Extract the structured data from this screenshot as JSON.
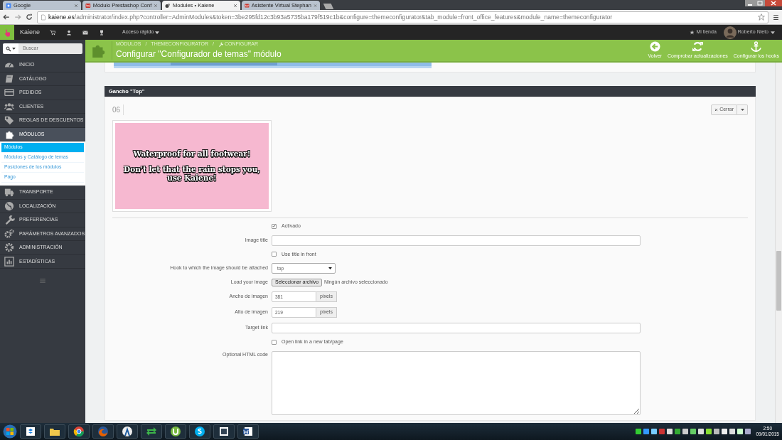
{
  "browser": {
    "tabs": [
      {
        "title": "Google",
        "selected": false
      },
      {
        "title": "Módulo Prestashop Conf",
        "selected": false
      },
      {
        "title": "Modules • Kaiene",
        "selected": true
      },
      {
        "title": "Asistente Virtual Stephan",
        "selected": false
      }
    ],
    "url_host": "kaiene.es",
    "url_path": "/administrator/index.php?controller=AdminModules&token=3be295fd12c3b93a5735ba179f519c1b&configure=themeconfigurator&tab_module=front_office_features&module_name=themeconfigurator"
  },
  "topbar": {
    "shop": "Kaiene",
    "quick_access": "Acceso rápido",
    "store_link": "Mi tienda",
    "user": "Roberto Nieto"
  },
  "sidebar": {
    "search_placeholder": "Buscar",
    "items": [
      {
        "label": "INICIO",
        "selected": false
      },
      {
        "label": "CATÁLOGO",
        "selected": false
      },
      {
        "label": "PEDIDOS",
        "selected": false
      },
      {
        "label": "CLIENTES",
        "selected": false
      },
      {
        "label": "REGLAS DE DESCUENTOS",
        "selected": false
      },
      {
        "label": "MÓDULOS",
        "selected": true,
        "children": [
          {
            "label": "Módulos",
            "selected": true
          },
          {
            "label": "Módulos y Catálogo de temas",
            "selected": false
          },
          {
            "label": "Posiciones de los módulos",
            "selected": false
          },
          {
            "label": "Pago",
            "selected": false
          }
        ]
      },
      {
        "label": "TRANSPORTE",
        "selected": false
      },
      {
        "label": "LOCALIZACIÓN",
        "selected": false
      },
      {
        "label": "PREFERENCIAS",
        "selected": false
      },
      {
        "label": "PARÁMETROS AVANZADOS",
        "selected": false
      },
      {
        "label": "ADMINISTRACIÓN",
        "selected": false
      },
      {
        "label": "ESTADÍSTICAS",
        "selected": false
      }
    ]
  },
  "header": {
    "breadcrumb": [
      "MÓDULOS",
      "THEMECONFIGURATOR",
      "CONFIGURAR"
    ],
    "breadcrumb_separators": [
      "/",
      "/"
    ],
    "title": "Configurar \"Configurador de temas\" módulo",
    "actions": [
      "Volver",
      "Comprobar actualizaciones",
      "Configurar los hooks"
    ]
  },
  "panel": {
    "title": "Gancho \"Top\"",
    "item_number": "06",
    "close_button": "Cerrar",
    "banner_lines": [
      "Waterproof for all footwear!",
      "Don't let that the rain stops you, use Kaiene!"
    ],
    "fields": [
      {
        "kind": "checkbox",
        "label": "Activado",
        "checked": true
      },
      {
        "kind": "text",
        "label": "Image title"
      },
      {
        "kind": "checkbox",
        "label": "Use title in front",
        "checked": false
      },
      {
        "kind": "select",
        "label": "Hook to which the image should be attached",
        "value": "top"
      },
      {
        "kind": "file",
        "label": "Load your image",
        "button": "Seleccionar archivo",
        "note": "Ningún archivo seleccionado"
      },
      {
        "kind": "number",
        "label": "Ancho de imagen",
        "value": "381",
        "unit": "pixels"
      },
      {
        "kind": "number",
        "label": "Alto de imagen",
        "value": "219",
        "unit": "pixels"
      },
      {
        "kind": "text",
        "label": "Target link"
      },
      {
        "kind": "checkbox",
        "label": "Open link in a new tab/page",
        "checked": false
      },
      {
        "kind": "textarea",
        "label": "Optional HTML code"
      }
    ]
  },
  "taskbar": {
    "time": "2:50",
    "date": "09/01/2015"
  }
}
